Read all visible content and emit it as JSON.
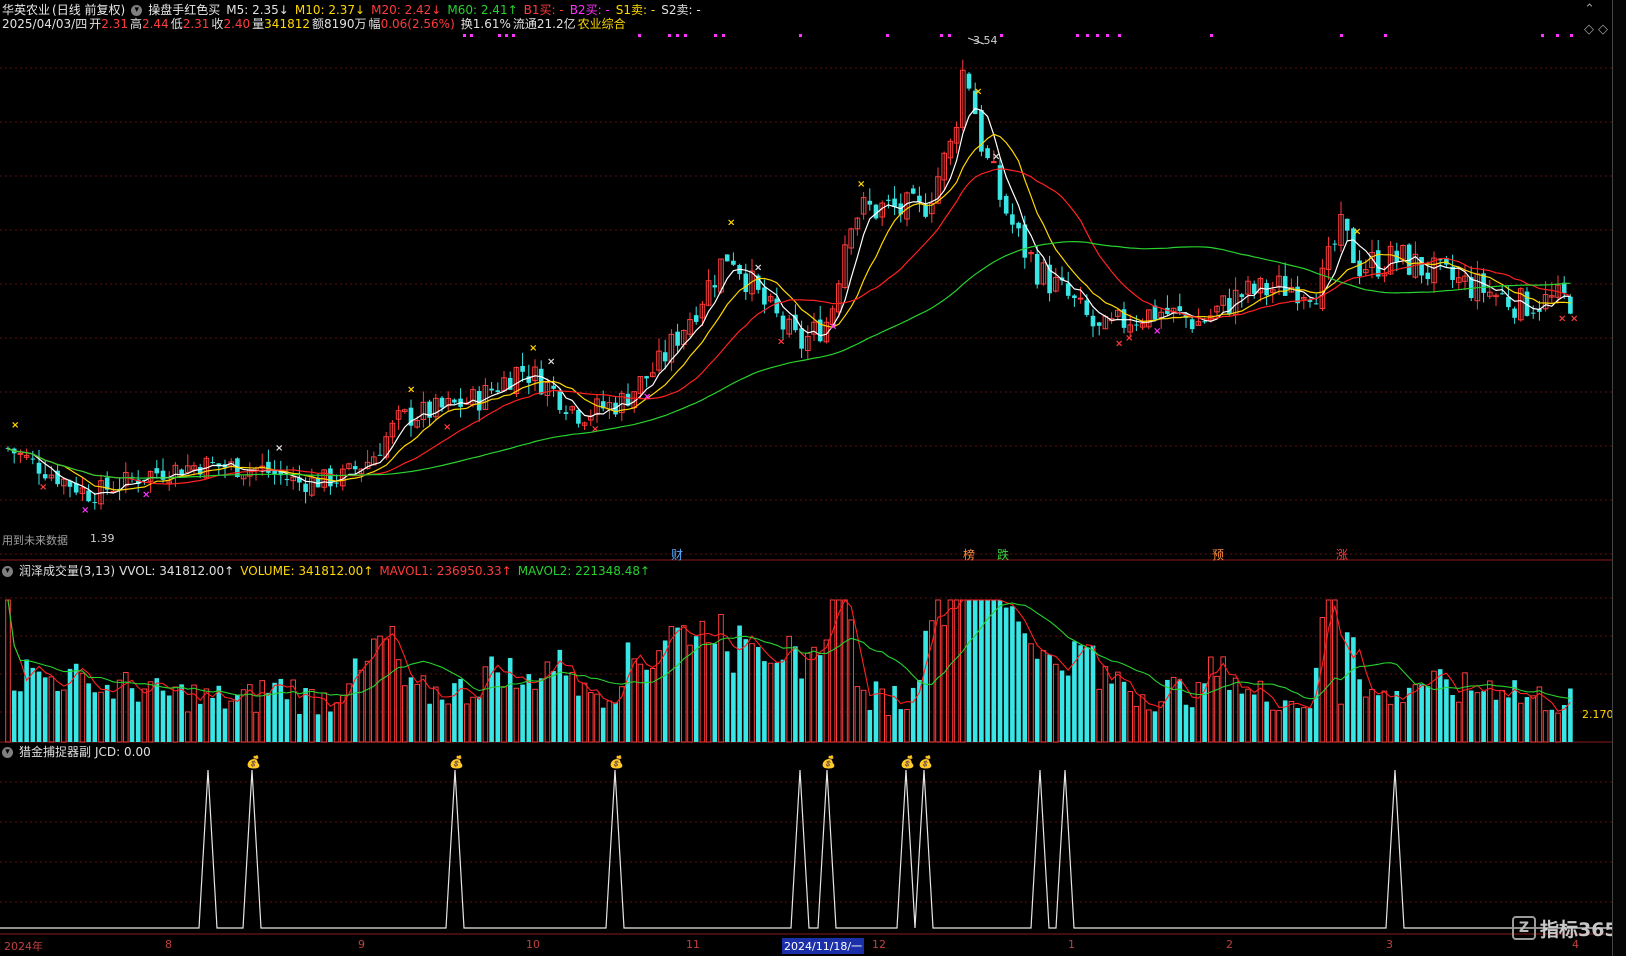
{
  "stock": {
    "name": "华英农业",
    "period": "(日线 前复权)",
    "indicator_name": "操盘手红色买",
    "m5": "M5: 2.35↓",
    "m10": "M10: 2.37↓",
    "m20": "M20: 2.42↓",
    "m60": "M60: 2.41↑",
    "b1": "B1买: -",
    "b2": "B2买: -",
    "s1": "S1卖: -",
    "s2": "S2卖: -",
    "date": "2025/04/03/四",
    "open_label": "开",
    "open": "2.31",
    "high_label": "高",
    "high": "2.44",
    "low_label": "低",
    "low": "2.31",
    "close_label": "收",
    "close": "2.40",
    "vol_label": "量",
    "vol": "341812",
    "amt_label": "额",
    "amt": "8190万",
    "chg_label": "幅",
    "chg": "0.06(2.56%)",
    "turn": "换1.61%",
    "float": "流通21.2亿",
    "sector": "农业综合"
  },
  "main_chart": {
    "max_label": "3.54",
    "min_label": "1.39",
    "future_note": "用到未来数据",
    "event_tags": [
      {
        "text": "财",
        "color": "#5aaaff"
      },
      {
        "text": "榜",
        "color": "#ff8c3c"
      },
      {
        "text": "跌",
        "color": "#3cd23c"
      },
      {
        "text": "预",
        "color": "#ff8c3c"
      },
      {
        "text": "涨",
        "color": "#ff3c3c"
      }
    ],
    "right_axis_mark": "2"
  },
  "volume_panel": {
    "title": "润泽成交量(3,13)",
    "vvol": "VVOL: 341812.00↑",
    "volume": "VOLUME: 341812.00↑",
    "mavol1": "MAVOL1: 236950.33↑",
    "mavol2": "MAVOL2: 221348.48↑",
    "unit_label": "2.170"
  },
  "jcd_panel": {
    "title": "猎金捕捉器副",
    "value": "JCD: 0.00",
    "signal_icon": "money-bag-icon"
  },
  "time_axis": {
    "labels": [
      "2024年",
      "8",
      "9",
      "10",
      "11",
      "2024/11/18/一",
      "12",
      "1",
      "2",
      "3",
      "4"
    ]
  },
  "brand": {
    "text": "指标365",
    "logo": "z-logo-icon"
  },
  "colors": {
    "up": "#ff3c3c",
    "down": "#39e6e6",
    "ma5": "#ffffff",
    "ma10": "#ffd800",
    "ma20": "#ff2020",
    "ma60": "#28d12e",
    "grid": "#5a1010"
  }
}
